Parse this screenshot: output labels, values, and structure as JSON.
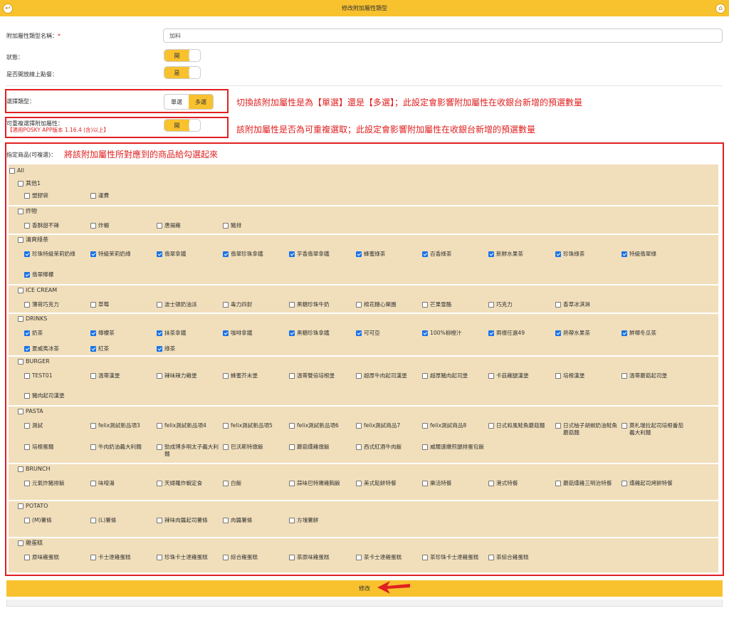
{
  "header": {
    "title": "修改附加屬性類型"
  },
  "form": {
    "name_label": "附加屬性類型名稱：",
    "name_required": "*",
    "name_value": "加料",
    "status_label": "狀態：",
    "status_toggle": "開",
    "online_label": "是否開放線上點餐：",
    "online_toggle": "是",
    "select_type_label": "選擇類型：",
    "single_label": "單選",
    "multi_label": "多選",
    "repeat_label": "可重複選擇附加屬性：",
    "repeat_warning": "【適用POSKY APP版本 1.16.4 (含)以上】",
    "repeat_toggle": "開",
    "products_label": "指定商品(可複選)："
  },
  "annotations": {
    "type_note": "切換該附加屬性是為【單選】還是【多選】；此設定會影響附加屬性在收銀台新增的預選數量",
    "repeat_note": "該附加屬性是否為可重複選取；此設定會影響附加屬性在收銀台新增的預選數量",
    "products_note": "將該附加屬性所對應到的商品給勾選起來"
  },
  "all_label": "All",
  "categories": [
    {
      "name": "其他1",
      "items": [
        {
          "label": "塑膠袋",
          "checked": false
        },
        {
          "label": "運費",
          "checked": false
        }
      ]
    },
    {
      "name": "炸物",
      "items": [
        {
          "label": "香酥甜不辣",
          "checked": false
        },
        {
          "label": "炸蝦",
          "checked": false
        },
        {
          "label": "唐揚雞",
          "checked": false
        },
        {
          "label": "豬排",
          "checked": false
        }
      ]
    },
    {
      "name": "清爽綠茶",
      "items": [
        {
          "label": "珍珠特級茉莉奶綠",
          "checked": true
        },
        {
          "label": "特級茉莉奶綠",
          "checked": true
        },
        {
          "label": "翡翠拿鐵",
          "checked": true
        },
        {
          "label": "翡翠珍珠拿鐵",
          "checked": true
        },
        {
          "label": "芋香翡翠拿鐵",
          "checked": true
        },
        {
          "label": "蜂蜜綠茶",
          "checked": true
        },
        {
          "label": "百香綠茶",
          "checked": true
        },
        {
          "label": "新鮮水果茶",
          "checked": true
        },
        {
          "label": "珍珠綠茶",
          "checked": true
        },
        {
          "label": "特級翡翠綠",
          "checked": true
        },
        {
          "label": "翡翠檸檬",
          "checked": true
        }
      ]
    },
    {
      "name": "ICE CREAM",
      "items": [
        {
          "label": "薄荷巧克力",
          "checked": false
        },
        {
          "label": "草莓",
          "checked": false
        },
        {
          "label": "波士頓奶油派",
          "checked": false
        },
        {
          "label": "毒力四射",
          "checked": false
        },
        {
          "label": "黑糖珍珠牛奶",
          "checked": false
        },
        {
          "label": "棉花糖心樂園",
          "checked": false
        },
        {
          "label": "芒果雪酪",
          "checked": false
        },
        {
          "label": "巧克力",
          "checked": false
        },
        {
          "label": "香草冰淇淋",
          "checked": false
        }
      ]
    },
    {
      "name": "DRINKS",
      "items": [
        {
          "label": "奶茶",
          "checked": true
        },
        {
          "label": "檸檬茶",
          "checked": true
        },
        {
          "label": "抹茶拿鐵",
          "checked": true
        },
        {
          "label": "咖啡拿鐵",
          "checked": true
        },
        {
          "label": "黑糖珍珠拿鐵",
          "checked": true
        },
        {
          "label": "可可亞",
          "checked": true
        },
        {
          "label": "100%柳橙汁",
          "checked": true
        },
        {
          "label": "兩樣任選49",
          "checked": true
        },
        {
          "label": "熱帶水果茶",
          "checked": true
        },
        {
          "label": "鮮檸冬瓜茶",
          "checked": true
        },
        {
          "label": "夏威夷冰茶",
          "checked": true
        },
        {
          "label": "紅茶",
          "checked": true
        },
        {
          "label": "綠茶",
          "checked": true
        }
      ]
    },
    {
      "name": "BURGER",
      "items": [
        {
          "label": "TEST01",
          "checked": false
        },
        {
          "label": "溫蒂漢堡",
          "checked": false
        },
        {
          "label": "辣味辣力雞堡",
          "checked": false
        },
        {
          "label": "蜂蜜芥末堡",
          "checked": false
        },
        {
          "label": "溫蒂雙倍培根堡",
          "checked": false
        },
        {
          "label": "超厚牛肉起司漢堡",
          "checked": false
        },
        {
          "label": "超厚豬肉起司堡",
          "checked": false
        },
        {
          "label": "卡茲雞腿漢堡",
          "checked": false
        },
        {
          "label": "培根漢堡",
          "checked": false
        },
        {
          "label": "溫蒂蘑菇起司堡",
          "checked": false
        },
        {
          "label": "豬肉起司漢堡",
          "checked": false
        }
      ]
    },
    {
      "name": "PASTA",
      "items": [
        {
          "label": "測試",
          "checked": false
        },
        {
          "label": "felix測試新品項3",
          "checked": false
        },
        {
          "label": "felix測試新品項4",
          "checked": false
        },
        {
          "label": "felix測試新品項5",
          "checked": false
        },
        {
          "label": "felix測試新品項6",
          "checked": false
        },
        {
          "label": "felix測試商品7",
          "checked": false
        },
        {
          "label": "felix測試商品8",
          "checked": false
        },
        {
          "label": "日式和風鮭魚蘑菇麵",
          "checked": false
        },
        {
          "label": "日式柚子胡椒奶油鮭魚蘑菇麵",
          "checked": false
        },
        {
          "label": "莫札瑞拉起司培根番茄義大利麵",
          "checked": false
        },
        {
          "label": "培根蛋麵",
          "checked": false
        },
        {
          "label": "牛肉奶油義大利麵",
          "checked": false
        },
        {
          "label": "勁成博多明太子義大利麵",
          "checked": false
        },
        {
          "label": "巴沃斯特燉飯",
          "checked": false
        },
        {
          "label": "蘑菇燻雞燉飯",
          "checked": false
        },
        {
          "label": "西式紅酒牛肉飯",
          "checked": false
        },
        {
          "label": "威爾遜嫩煎腿排蛋包飯",
          "checked": false
        }
      ]
    },
    {
      "name": "BRUNCH",
      "items": [
        {
          "label": "元氣炸豬排飯",
          "checked": false
        },
        {
          "label": "味噌湯",
          "checked": false
        },
        {
          "label": "天婦羅炸蝦定食",
          "checked": false
        },
        {
          "label": "白飯",
          "checked": false
        },
        {
          "label": "蒜味巴特嫩雞胸飯",
          "checked": false
        },
        {
          "label": "美式鬆餅特餐",
          "checked": false
        },
        {
          "label": "樂活特餐",
          "checked": false
        },
        {
          "label": "港式特餐",
          "checked": false
        },
        {
          "label": "蘑菇燻雞三明治特餐",
          "checked": false
        },
        {
          "label": "燻雞起司烤餅特餐",
          "checked": false
        }
      ]
    },
    {
      "name": "POTATO",
      "items": [
        {
          "label": "(M)薯條",
          "checked": false
        },
        {
          "label": "(L)薯條",
          "checked": false
        },
        {
          "label": "辣味肉醬起司薯條",
          "checked": false
        },
        {
          "label": "肉醬薯條",
          "checked": false
        },
        {
          "label": "方塊薯餅",
          "checked": false
        }
      ]
    },
    {
      "name": "雞蛋糕",
      "items": [
        {
          "label": "原味雞蛋糕",
          "checked": false
        },
        {
          "label": "卡士達雞蛋糕",
          "checked": false
        },
        {
          "label": "珍珠卡士達雞蛋糕",
          "checked": false
        },
        {
          "label": "綜合雞蛋糕",
          "checked": false
        },
        {
          "label": "茶原味雞蛋糕",
          "checked": false
        },
        {
          "label": "茶卡士達雞蛋糕",
          "checked": false
        },
        {
          "label": "茶珍珠卡士達雞蛋糕",
          "checked": false
        },
        {
          "label": "茶綜合雞蛋糕",
          "checked": false
        }
      ]
    }
  ],
  "submit_label": "修改",
  "colors": {
    "accent": "#f8c12e",
    "annotation": "#e02020",
    "product_bg": "#f1dfbb",
    "checked": "#1a73e8"
  }
}
